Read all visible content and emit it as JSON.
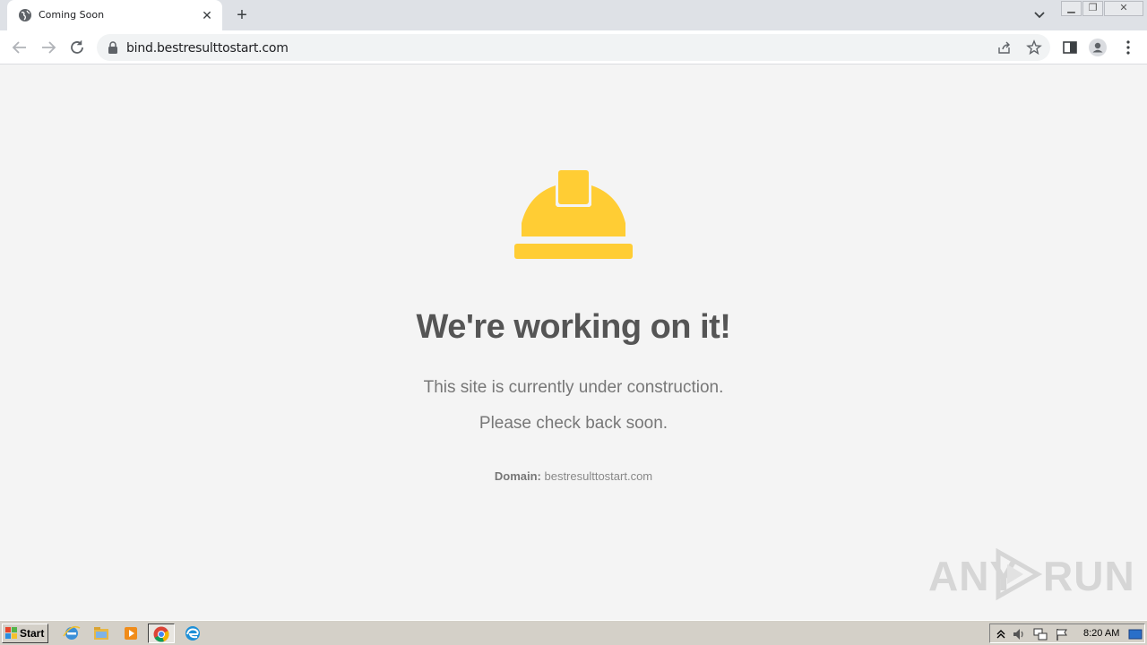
{
  "browser": {
    "tab": {
      "title": "Coming Soon",
      "close_label": "✕"
    },
    "new_tab_label": "+",
    "url": "bind.bestresulttostart.com"
  },
  "page": {
    "headline": "We're working on it!",
    "line1": "This site is currently under construction.",
    "line2": "Please check back soon.",
    "domain_label": "Domain:",
    "domain_value": "bestresulttostart.com",
    "helmet_color": "#ffcd34"
  },
  "watermark": {
    "left": "ANY",
    "right": "RUN"
  },
  "taskbar": {
    "start_label": "Start",
    "clock": "8:20 AM"
  }
}
